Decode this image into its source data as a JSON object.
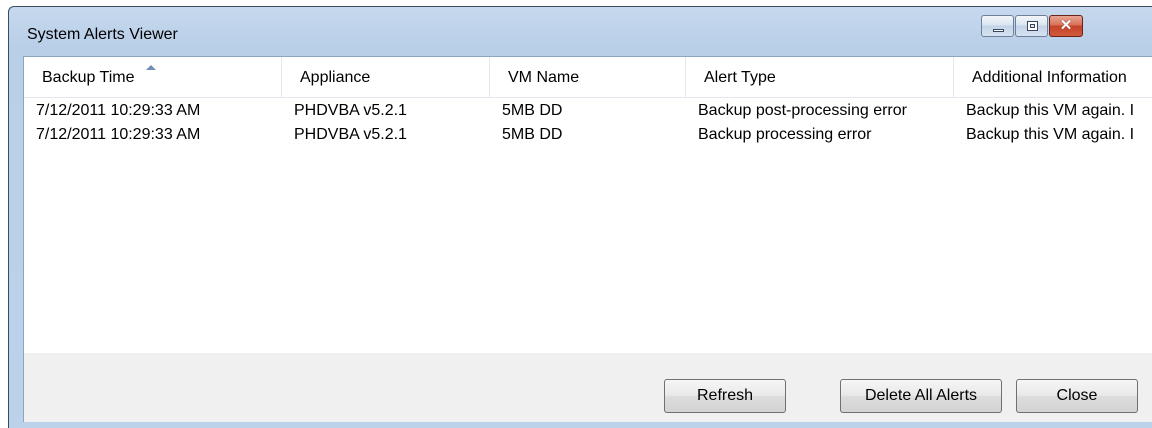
{
  "window": {
    "title": "System Alerts Viewer"
  },
  "table": {
    "columns": [
      "Backup Time",
      "Appliance",
      "VM Name",
      "Alert Type",
      "Additional Information"
    ],
    "sorted_column": "Backup Time",
    "rows": [
      [
        "7/12/2011 10:29:33 AM",
        "PHDVBA v5.2.1",
        "5MB DD",
        "Backup post-processing error",
        "Backup this VM again. I"
      ],
      [
        "7/12/2011 10:29:33 AM",
        "PHDVBA v5.2.1",
        "5MB DD",
        "Backup processing error",
        "Backup this VM again. I"
      ]
    ]
  },
  "buttons": {
    "refresh": "Refresh",
    "delete_all": "Delete All Alerts",
    "close": "Close"
  },
  "caption": {
    "close_glyph": "✕"
  }
}
